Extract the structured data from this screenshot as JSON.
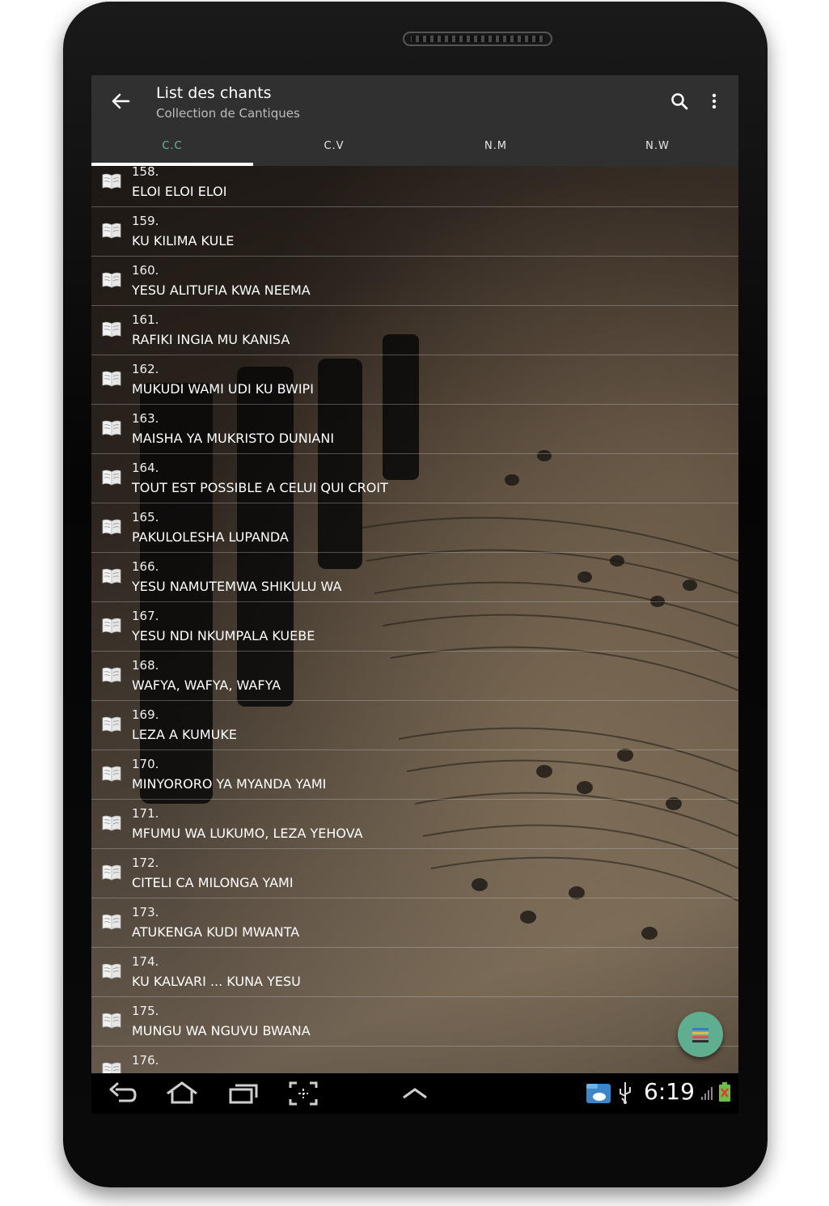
{
  "appbar": {
    "title": "List des chants",
    "subtitle": "Collection de Cantiques"
  },
  "tabs": [
    {
      "label": "C.C",
      "active": true
    },
    {
      "label": "C.V",
      "active": false
    },
    {
      "label": "N.M",
      "active": false
    },
    {
      "label": "N.W",
      "active": false
    }
  ],
  "songs": [
    {
      "number": "158.",
      "title": "ELOI  ELOI ELOI"
    },
    {
      "number": "159.",
      "title": "KU KILIMA KULE"
    },
    {
      "number": "160.",
      "title": "YESU ALITUFIA KWA NEEMA"
    },
    {
      "number": "161.",
      "title": "RAFIKI INGIA MU KANISA"
    },
    {
      "number": "162.",
      "title": "MUKUDI WAMI UDI KU BWIPI"
    },
    {
      "number": "163.",
      "title": "MAISHA YA MUKRISTO DUNIANI"
    },
    {
      "number": "164.",
      "title": "TOUT EST POSSIBLE A CELUI QUI CROIT"
    },
    {
      "number": "165.",
      "title": "PAKULOLESHA LUPANDA"
    },
    {
      "number": "166.",
      "title": "YESU NAMUTEMWA SHIKULU WA"
    },
    {
      "number": "167.",
      "title": "YESU NDI NKUMPALA KUEBE"
    },
    {
      "number": "168.",
      "title": "WAFYA, WAFYA, WAFYA"
    },
    {
      "number": "169.",
      "title": "LEZA A KUMUKE"
    },
    {
      "number": "170.",
      "title": "MINYORORO YA MYANDA YAMI"
    },
    {
      "number": "171.",
      "title": "MFUMU WA LUKUMO, LEZA YEHOVA"
    },
    {
      "number": "172.",
      "title": "CITELI CA MILONGA YAMI"
    },
    {
      "number": "173.",
      "title": "ATUKENGA KUDI MWANTA"
    },
    {
      "number": "174.",
      "title": "KU KALVARI ... KUNA YESU"
    },
    {
      "number": "175.",
      "title": "MUNGU WA NGUVU BWANA"
    },
    {
      "number": "176.",
      "title": ""
    }
  ],
  "status": {
    "time": "6:19"
  },
  "icons": {
    "back": "arrow-back-icon",
    "search": "search-icon",
    "more": "more-vert-icon",
    "song": "open-book-icon",
    "fab": "list-bars-icon"
  },
  "colors": {
    "appbar": "#303030",
    "tab_active": "#66bb9a",
    "fab": "#5fae90"
  }
}
